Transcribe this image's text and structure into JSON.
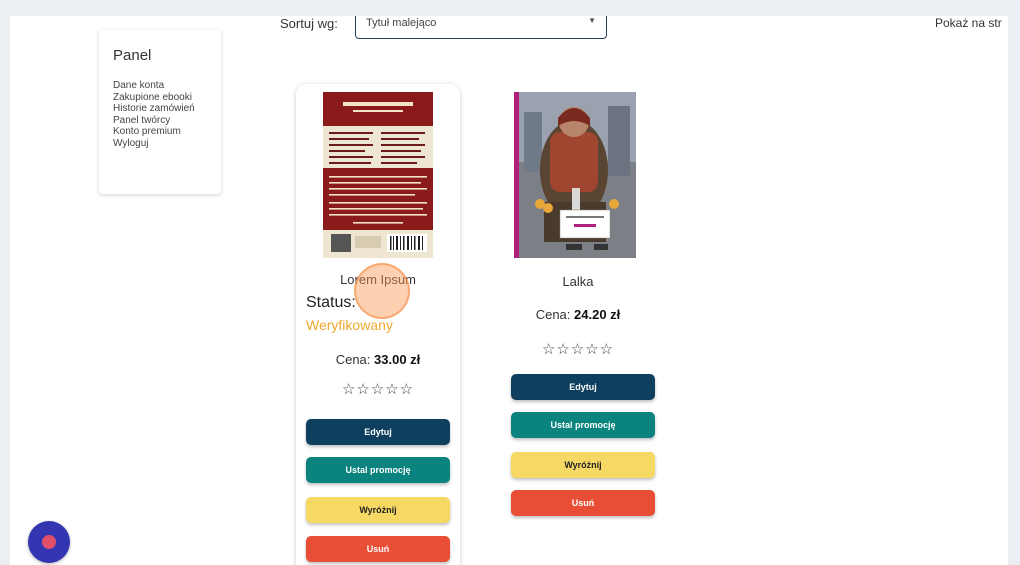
{
  "sort": {
    "label": "Sortuj wg:",
    "selected": "Tytuł malejąco"
  },
  "per_page_label": "Pokaż na str",
  "panel": {
    "title": "Panel",
    "links": [
      "Dane konta",
      "Zakupione ebooki",
      "Historie zamówień",
      "Panel twórcy",
      "Konto premium",
      "Wyloguj"
    ]
  },
  "books": [
    {
      "title": "Lorem Ipsum",
      "status_label": "Status:",
      "status_value": "Weryfikowany",
      "price_label": "Cena:",
      "price_value": "33.00 zł",
      "rating": 0,
      "stars": "☆☆☆☆☆",
      "buttons": {
        "edit": "Edytuj",
        "promo": "Ustal promocję",
        "feature": "Wyróżnij",
        "delete": "Usuń"
      }
    },
    {
      "title": "Lalka",
      "price_label": "Cena:",
      "price_value": "24.20 zł",
      "rating": 0,
      "stars": "☆☆☆☆☆",
      "buttons": {
        "edit": "Edytuj",
        "promo": "Ustal promocję",
        "feature": "Wyróżnij",
        "delete": "Usuń"
      }
    }
  ],
  "colors": {
    "edit": "#0e3f5e",
    "promo": "#0b837e",
    "feature": "#f6d865",
    "delete": "#e84d35",
    "status": "#f0a830",
    "fab": "#3336b0"
  }
}
